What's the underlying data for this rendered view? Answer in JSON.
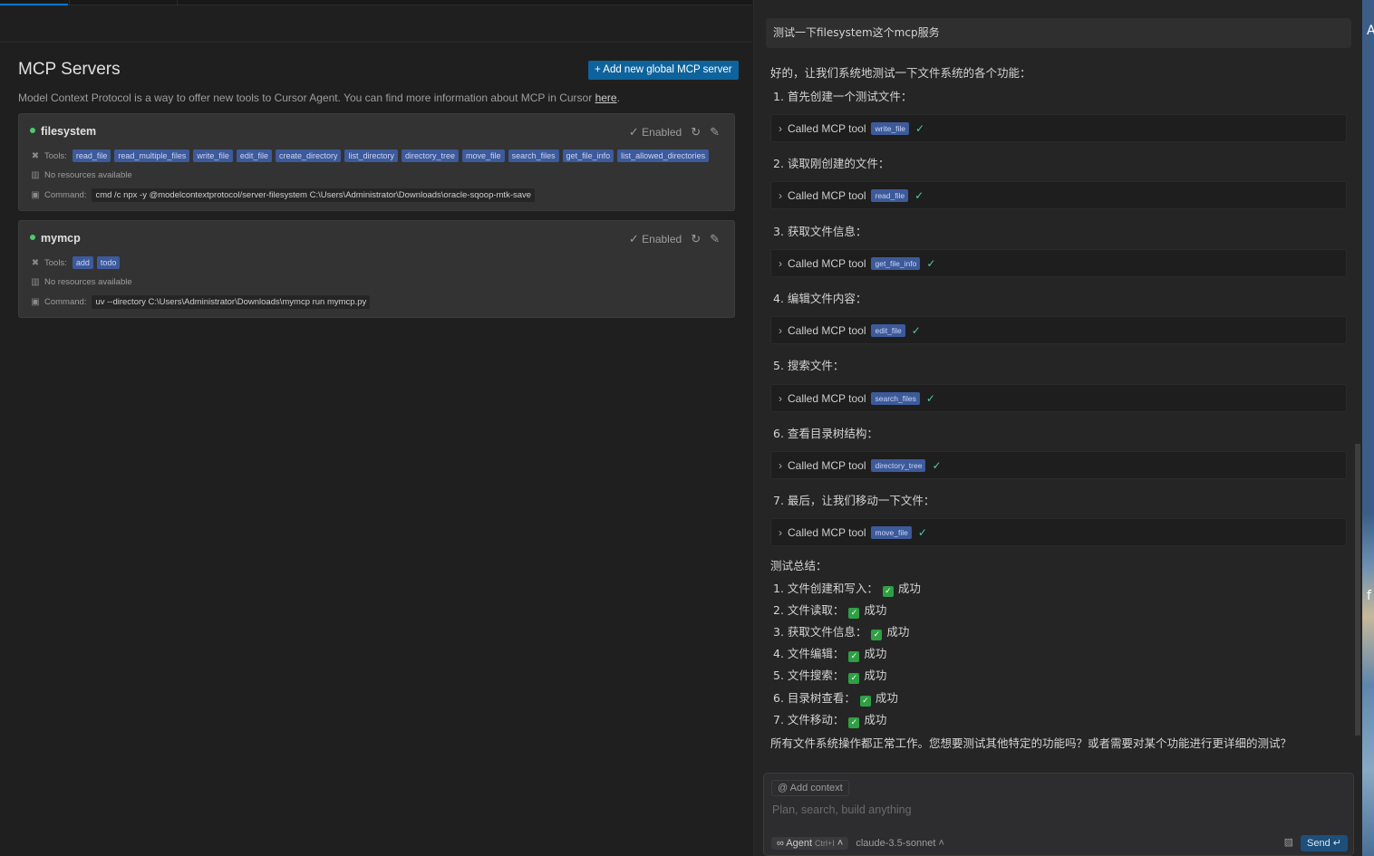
{
  "left": {
    "title": "MCP Servers",
    "add_button": "+ Add new global MCP server",
    "description": "Model Context Protocol is a way to offer new tools to Cursor Agent. You can find more information about MCP in Cursor ",
    "description_link": "here",
    "description_end": ".",
    "servers": [
      {
        "name": "filesystem",
        "status": "Enabled",
        "tools_label": "Tools:",
        "tools": [
          "read_file",
          "read_multiple_files",
          "write_file",
          "edit_file",
          "create_directory",
          "list_directory",
          "directory_tree",
          "move_file",
          "search_files",
          "get_file_info",
          "list_allowed_directories"
        ],
        "resources": "No resources available",
        "command_label": "Command:",
        "command": "cmd /c npx -y @modelcontextprotocol/server-filesystem C:\\Users\\Administrator\\Downloads\\oracle-sqoop-mtk-save"
      },
      {
        "name": "mymcp",
        "status": "Enabled",
        "tools_label": "Tools:",
        "tools": [
          "add",
          "todo"
        ],
        "resources": "No resources available",
        "command_label": "Command:",
        "command": "uv --directory C:\\Users\\Administrator\\Downloads\\mymcp run mymcp.py"
      }
    ]
  },
  "chat": {
    "user_message": "测试一下filesystem这个mcp服务",
    "intro": "好的，让我们系统地测试一下文件系统的各个功能：",
    "steps": [
      {
        "text": "1. 首先创建一个测试文件：",
        "tool": "write_file"
      },
      {
        "text": "2. 读取刚创建的文件：",
        "tool": "read_file"
      },
      {
        "text": "3. 获取文件信息：",
        "tool": "get_file_info"
      },
      {
        "text": "4. 编辑文件内容：",
        "tool": "edit_file"
      },
      {
        "text": "5. 搜索文件：",
        "tool": "search_files"
      },
      {
        "text": "6. 查看目录树结构：",
        "tool": "directory_tree"
      },
      {
        "text": "7. 最后，让我们移动一下文件：",
        "tool": "move_file"
      }
    ],
    "called_label": "Called MCP tool",
    "summary_title": "测试总结：",
    "summary": [
      {
        "label": "1. 文件创建和写入：",
        "result": "成功"
      },
      {
        "label": "2. 文件读取：",
        "result": "成功"
      },
      {
        "label": "3. 获取文件信息：",
        "result": "成功"
      },
      {
        "label": "4. 文件编辑：",
        "result": "成功"
      },
      {
        "label": "5. 文件搜索：",
        "result": "成功"
      },
      {
        "label": "6. 目录树查看：",
        "result": "成功"
      },
      {
        "label": "7. 文件移动：",
        "result": "成功"
      }
    ],
    "closing": "所有文件系统操作都正常工作。您想要测试其他特定的功能吗？或者需要对某个功能进行更详细的测试？"
  },
  "composer": {
    "add_context": "Add context",
    "placeholder": "Plan, search, build anything",
    "mode": "Agent",
    "mode_shortcut": "Ctrl+I",
    "model": "claude-3.5-sonnet",
    "send": "Send"
  },
  "desktop": {
    "char_a": "A",
    "char_b": "f"
  }
}
